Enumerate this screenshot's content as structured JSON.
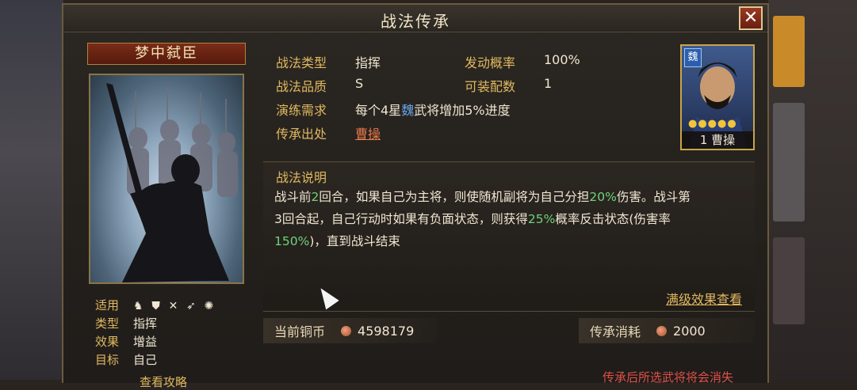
{
  "window": {
    "title": "战法传承",
    "close_label": "✕"
  },
  "skill": {
    "name": "梦中弑臣",
    "meta": [
      {
        "key": "适用",
        "icons": [
          "cavalry-icon",
          "shield-icon",
          "bow-icon",
          "spear-icon",
          "wheel-icon"
        ]
      },
      {
        "key": "类型",
        "value": "指挥"
      },
      {
        "key": "效果",
        "value": "增益"
      },
      {
        "key": "目标",
        "value": "自己"
      }
    ],
    "guide_link": "查看攻略"
  },
  "info": {
    "type_label": "战法类型",
    "type_value": "指挥",
    "rate_label": "发动概率",
    "rate_value": "100%",
    "quality_label": "战法品质",
    "quality_value": "S",
    "slots_label": "可装配数",
    "slots_value": "1",
    "req_label": "演练需求",
    "req_prefix": "每个4星",
    "req_faction": "魏",
    "req_suffix": "武将增加5%进度",
    "source_label": "传承出处",
    "source_value": "曹操"
  },
  "hero": {
    "faction": "魏",
    "stars": "●●●●●",
    "level": "1",
    "name": "曹操"
  },
  "description": {
    "title": "战法说明",
    "line1_a": "战斗前",
    "line1_g1": "2",
    "line1_b": "回合，如果自己为主将，则使随机副将为自己分担",
    "line1_g2": "20%",
    "line1_c": "伤害。战斗第",
    "line2_a": "3回合起，自己行动时如果有负面状态，则获得",
    "line2_g": "25%",
    "line2_b": "概率反击状态(伤害率",
    "line3_g": "150%",
    "line3_b": ")，直到战斗结束",
    "full_effect_link": "满级效果查看"
  },
  "currency": {
    "current_label": "当前铜币",
    "current_value": "4598179",
    "cost_label": "传承消耗",
    "cost_value": "2000"
  },
  "warning": "传承后所选武将将会消失"
}
